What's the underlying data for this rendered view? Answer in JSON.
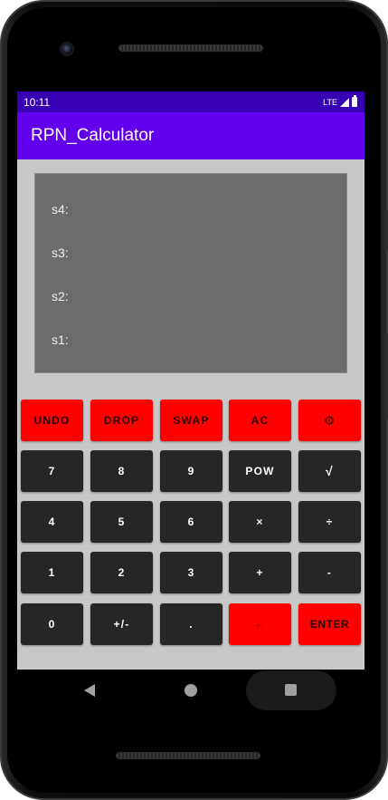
{
  "status_bar": {
    "time": "10:11",
    "network": "LTE"
  },
  "app_bar": {
    "title": "RPN_Calculator"
  },
  "display": {
    "stack": [
      {
        "label": "s4:",
        "value": ""
      },
      {
        "label": "s3:",
        "value": ""
      },
      {
        "label": "s2:",
        "value": ""
      },
      {
        "label": "s1:",
        "value": ""
      }
    ]
  },
  "keys": {
    "undo": "UNDO",
    "drop": "DROP",
    "swap": "SWAP",
    "ac": "AC",
    "settings": "⚙",
    "seven": "7",
    "eight": "8",
    "nine": "9",
    "pow": "POW",
    "sqrt": "√",
    "four": "4",
    "five": "5",
    "six": "6",
    "multiply": "×",
    "divide": "÷",
    "one": "1",
    "two": "2",
    "three": "3",
    "plus": "+",
    "minus": "-",
    "zero": "0",
    "negate": "+/-",
    "decimal": ".",
    "backspace": "←",
    "enter": "ENTER"
  },
  "colors": {
    "status_bar": "#3700b3",
    "app_bar": "#6200ee",
    "screen_background": "#c8c8c8",
    "display_background": "#6c6c6c",
    "key_dark": "#262626",
    "key_red": "#ff0000"
  }
}
